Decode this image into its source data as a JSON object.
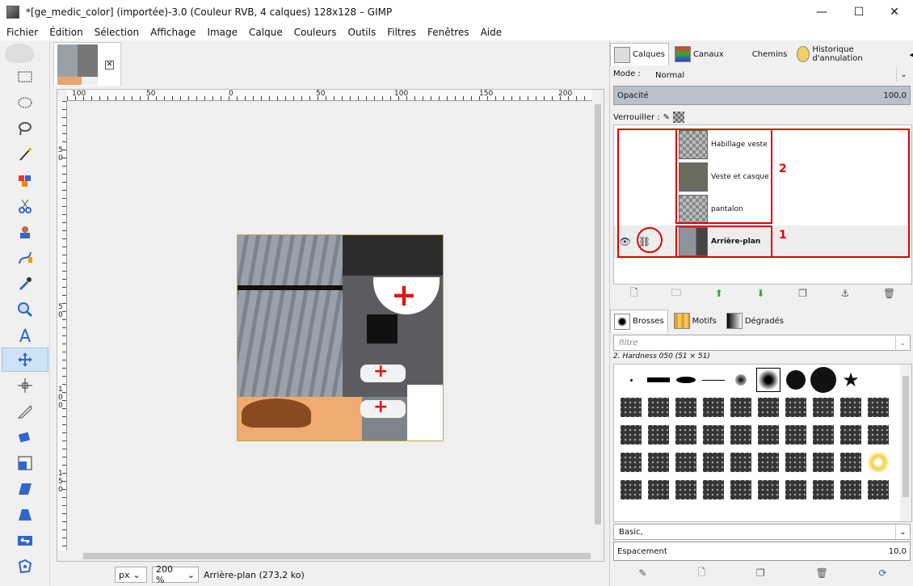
{
  "window": {
    "title": "*[ge_medic_color] (importée)-3.0 (Couleur RVB, 4 calques) 128x128 – GIMP",
    "minimize": "—",
    "maximize": "☐",
    "close": "✕"
  },
  "menu": [
    "Fichier",
    "Édition",
    "Sélection",
    "Affichage",
    "Image",
    "Calque",
    "Couleurs",
    "Outils",
    "Filtres",
    "Fenêtres",
    "Aide"
  ],
  "tools": [
    "rect-select",
    "ellipse-select",
    "free-select",
    "fuzzy-select",
    "color-select",
    "scissors",
    "foreground-select",
    "paths",
    "color-picker",
    "zoom",
    "measure",
    "move",
    "align",
    "crop",
    "rotate",
    "scale",
    "shear",
    "perspective",
    "flip",
    "cage"
  ],
  "image_tab": {
    "close": "✕"
  },
  "rulers": {
    "h": [
      "100",
      "50",
      "0",
      "50",
      "100",
      "150",
      "200"
    ],
    "v": [
      "5",
      "0",
      "5",
      "0",
      "1",
      "0",
      "0",
      "1",
      "5",
      "0"
    ]
  },
  "status": {
    "unit": "px",
    "zoom": "200 %",
    "info": "Arrière-plan (273,2 ko)"
  },
  "layers_dock": {
    "tabs": [
      {
        "label": "Calques"
      },
      {
        "label": "Canaux"
      },
      {
        "label": "Chemins"
      },
      {
        "label": "Historique d'annulation"
      }
    ],
    "mode_label": "Mode :",
    "mode_value": "Normal",
    "opacity_label": "Opacité",
    "opacity_value": "100,0",
    "lock_label": "Verrouiller :",
    "layers": [
      {
        "name": "Habillage veste"
      },
      {
        "name": "Veste et casque"
      },
      {
        "name": "pantalon"
      },
      {
        "name": "Arrière-plan"
      }
    ],
    "annotation_group": "2",
    "annotation_bg": "1"
  },
  "brushes_dock": {
    "tabs": [
      {
        "label": "Brosses"
      },
      {
        "label": "Motifs"
      },
      {
        "label": "Dégradés"
      }
    ],
    "filter_placeholder": "filtre",
    "current": "2. Hardness 050 (51 × 51)",
    "preset": "Basic,",
    "spacing_label": "Espacement",
    "spacing_value": "10,0"
  },
  "colors": {
    "accent": "#e00000",
    "selected_tool": "#cfe3f7"
  }
}
